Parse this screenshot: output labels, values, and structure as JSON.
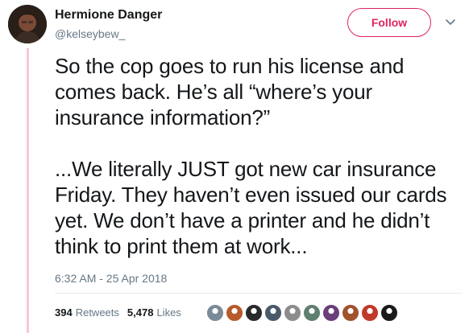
{
  "author": {
    "name": "Hermione Danger",
    "handle": "@kelseybew_",
    "avatar_icon": "user-avatar-photo"
  },
  "actions": {
    "follow_label": "Follow",
    "menu_icon": "chevron-down-icon",
    "accent_color": "#e0245e"
  },
  "tweet": {
    "paragraph_1": "So the cop goes to run his license and comes back. He’s all “where’s your insurance information?”",
    "paragraph_2": "...We literally JUST got new car insurance Friday. They haven’t even issued our cards yet. We don’t have a printer and he didn’t think to print them at work...",
    "timestamp": "6:32 AM - 25 Apr 2018"
  },
  "stats": {
    "retweets_count": "394",
    "retweets_label": "Retweets",
    "likes_count": "5,478",
    "likes_label": "Likes"
  },
  "likers": {
    "avatar_colors": [
      "#7a8a99",
      "#b85a2a",
      "#2b2b2b",
      "#4a5a6a",
      "#8c8c8c",
      "#5f7f6f",
      "#6b3f7a",
      "#a0522d",
      "#c0392b",
      "#1a1a1a"
    ]
  },
  "colors": {
    "thread_line": "#f6c8d3",
    "secondary_text": "#657786",
    "primary_text": "#14171a"
  }
}
